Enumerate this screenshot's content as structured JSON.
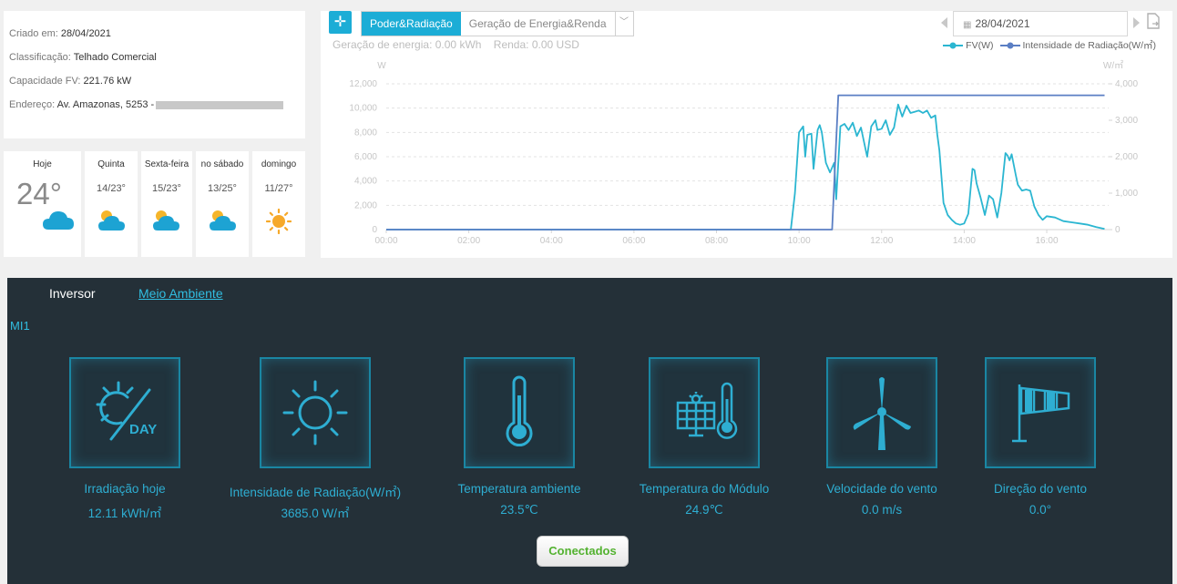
{
  "info": {
    "created_label": "Criado em:",
    "created_value": "28/04/2021",
    "class_label": "Classificação:",
    "class_value": "Telhado Comercial",
    "capacity_label": "Capacidade FV:",
    "capacity_value": "221.76 kW",
    "address_label": "Endereço:",
    "address_value": "Av. Amazonas, 5253 -"
  },
  "weather": [
    {
      "day": "Hoje",
      "temp": "24°",
      "icon": "cloud-icon"
    },
    {
      "day": "Quinta",
      "temp": "14/23°",
      "icon": "partly-cloudy-icon"
    },
    {
      "day": "Sexta-feira",
      "temp": "15/23°",
      "icon": "partly-cloudy-icon"
    },
    {
      "day": "no sábado",
      "temp": "13/25°",
      "icon": "partly-cloudy-icon"
    },
    {
      "day": "domingo",
      "temp": "11/27°",
      "icon": "sun-icon"
    }
  ],
  "chart_header": {
    "tab_power": "Poder&Radiação",
    "tab_energy": "Geração de Energia&Renda",
    "summary_energy_label": "Geração de energia:",
    "summary_energy_value": "0.00 kWh",
    "summary_income_label": "Renda:",
    "summary_income_value": "0.00 USD",
    "date": "28/04/2021"
  },
  "chart_data": {
    "type": "line",
    "ylabel_left": "W",
    "ylabel_right": "W/㎡",
    "x_ticks": [
      "00:00",
      "02:00",
      "04:00",
      "06:00",
      "08:00",
      "10:00",
      "12:00",
      "14:00",
      "16:00"
    ],
    "x_range_hours": [
      0,
      17.5
    ],
    "yleft_ticks": [
      0,
      2000,
      4000,
      6000,
      8000,
      10000,
      12000
    ],
    "yleft_tick_labels": [
      "0",
      "2,000",
      "4,000",
      "6,000",
      "8,000",
      "10,000",
      "12,000"
    ],
    "yleft_range": [
      0,
      12000
    ],
    "yright_ticks": [
      0,
      1000,
      2000,
      3000,
      4000
    ],
    "yright_tick_labels": [
      "0",
      "1,000",
      "2,000",
      "3,000",
      "4,000"
    ],
    "yright_range": [
      0,
      4000
    ],
    "grid": "horizontal dashed",
    "legend_position": "top-right",
    "series": [
      {
        "name": "FV(W)",
        "color": "#2bb6d1",
        "axis": "left",
        "x": [
          0,
          9.8,
          9.9,
          10.0,
          10.1,
          10.15,
          10.2,
          10.3,
          10.35,
          10.45,
          10.5,
          10.55,
          10.65,
          10.75,
          10.85,
          10.9,
          11.0,
          11.1,
          11.2,
          11.3,
          11.4,
          11.5,
          11.6,
          11.65,
          11.75,
          11.85,
          11.9,
          12.0,
          12.1,
          12.2,
          12.3,
          12.4,
          12.5,
          12.6,
          12.7,
          12.8,
          12.9,
          13.0,
          13.1,
          13.2,
          13.3,
          13.35,
          13.4,
          13.5,
          13.6,
          13.7,
          13.8,
          13.9,
          14.0,
          14.1,
          14.2,
          14.25,
          14.3,
          14.4,
          14.5,
          14.6,
          14.7,
          14.8,
          14.9,
          15.0,
          15.05,
          15.1,
          15.15,
          15.25,
          15.3,
          15.4,
          15.5,
          15.6,
          15.7,
          15.8,
          15.9,
          16.0,
          16.2,
          16.4,
          16.6,
          16.8,
          17.0,
          17.2,
          17.4
        ],
        "y": [
          0,
          0,
          3000,
          8000,
          8500,
          6000,
          7800,
          7900,
          5000,
          8200,
          8600,
          8000,
          5500,
          4700,
          5500,
          2500,
          8500,
          8700,
          8200,
          8800,
          7700,
          8400,
          6800,
          6000,
          8500,
          9000,
          8200,
          8300,
          9000,
          7800,
          8400,
          10300,
          9300,
          10200,
          9600,
          9700,
          9800,
          9600,
          9800,
          9200,
          9400,
          7800,
          6500,
          2200,
          1200,
          800,
          500,
          400,
          500,
          1300,
          5000,
          4900,
          3800,
          2600,
          1200,
          2800,
          2500,
          1000,
          3000,
          6300,
          6100,
          5700,
          6200,
          4500,
          3700,
          3200,
          3300,
          3200,
          1900,
          1200,
          800,
          1100,
          1000,
          700,
          600,
          500,
          400,
          200,
          50
        ]
      },
      {
        "name": "Intensidade de Radiação(W/㎡)",
        "color": "#5b7fc4",
        "axis": "right",
        "x": [
          0,
          10.8,
          10.95,
          17.4
        ],
        "y": [
          0,
          0,
          3685,
          3685
        ]
      }
    ]
  },
  "bottom_tabs": {
    "inverter": "Inversor",
    "environment": "Meio Ambiente"
  },
  "device_label": "MI1",
  "metrics": [
    {
      "label": "Irradiação hoje",
      "value": "12.11 kWh/㎡",
      "icon": "sun-day-icon"
    },
    {
      "label": "Intensidade de Radiação(W/㎡)",
      "value": "3685.0 W/㎡",
      "icon": "sun-icon"
    },
    {
      "label": "Temperatura ambiente",
      "value": "23.5℃",
      "icon": "thermometer-icon"
    },
    {
      "label": "Temperatura do Módulo",
      "value": "24.9℃",
      "icon": "module-thermometer-icon"
    },
    {
      "label": "Velocidade do vento",
      "value": "0.0 m/s",
      "icon": "wind-turbine-icon"
    },
    {
      "label": "Direção do vento",
      "value": "0.0°",
      "icon": "windsock-icon"
    }
  ],
  "status_button": "Conectados"
}
